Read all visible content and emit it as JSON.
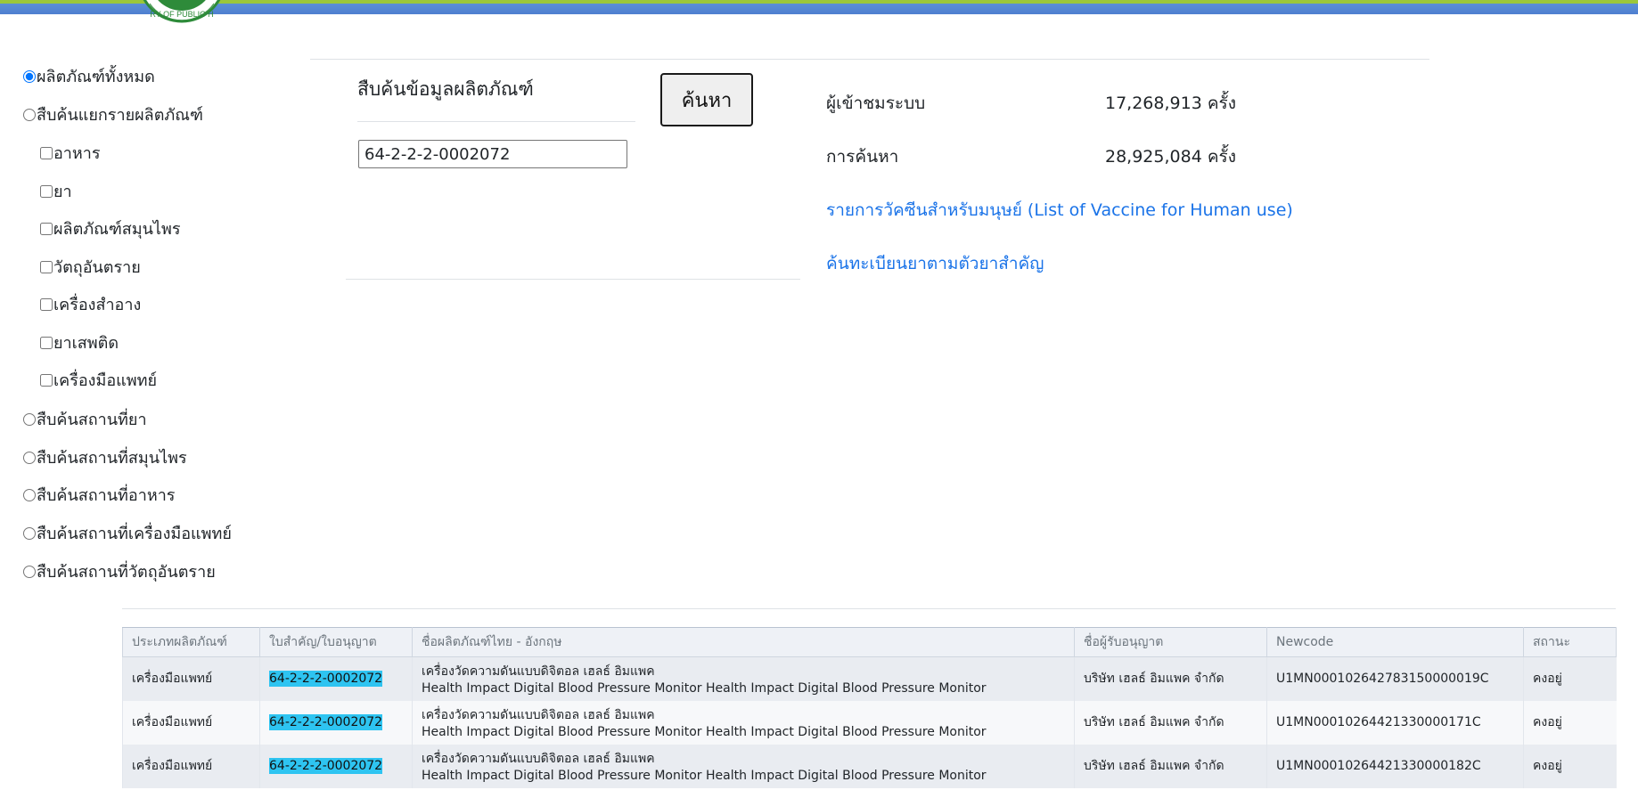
{
  "sidebar": {
    "all_products": "ผลิตภัณฑ์ทั้งหมด",
    "by_product": "สืบค้นแยกรายผลิตภัณฑ์",
    "categories": [
      {
        "label": "อาหาร"
      },
      {
        "label": "ยา"
      },
      {
        "label": "ผลิตภัณฑ์สมุนไพร"
      },
      {
        "label": "วัตถุอันตราย"
      },
      {
        "label": "เครื่องสำอาง"
      },
      {
        "label": "ยาเสพติด"
      },
      {
        "label": "เครื่องมือแพทย์"
      }
    ],
    "places": [
      {
        "label": "สืบค้นสถานที่ยา"
      },
      {
        "label": "สืบค้นสถานที่สมุนไพร"
      },
      {
        "label": "สืบค้นสถานที่อาหาร"
      },
      {
        "label": "สืบค้นสถานที่เครื่องมือแพทย์"
      },
      {
        "label": "สืบค้นสถานที่วัตถุอันตราย"
      }
    ]
  },
  "search": {
    "title": "สืบค้นข้อมูลผลิตภัณฑ์",
    "button": "ค้นหา",
    "value": "64-2-2-2-0002072"
  },
  "stats": {
    "visitors_label": "ผู้เข้าชมระบบ",
    "visitors_value": "17,268,913 ครั้ง",
    "searches_label": "การค้นหา",
    "searches_value": "28,925,084 ครั้ง"
  },
  "links": {
    "vaccine": "รายการวัคซีนสำหรับมนุษย์ (List of Vaccine for Human use)",
    "drug_search": "ค้นทะเบียนยาตามตัวยาสำคัญ"
  },
  "table": {
    "headers": [
      "ประเภทผลิตภัณฑ์",
      "ใบสำคัญ/ใบอนุญาต",
      "ชื่อผลิตภัณฑ์ไทย - อังกฤษ",
      "ชื่อผู้รับอนุญาต",
      "Newcode",
      "สถานะ"
    ],
    "rows": [
      {
        "type": "เครื่องมือแพทย์",
        "license": "64-2-2-2-0002072",
        "name_th": "เครื่องวัดความดันแบบดิจิตอล เฮลธ์ อิมแพค",
        "name_en": "Health Impact Digital Blood Pressure Monitor Health Impact Digital Blood Pressure Monitor",
        "licensee": "บริษัท เฮลธ์ อิมแพค จำกัด",
        "newcode": "U1MN000102642783150000019C",
        "status": "คงอยู่"
      },
      {
        "type": "เครื่องมือแพทย์",
        "license": "64-2-2-2-0002072",
        "name_th": "เครื่องวัดความดันแบบดิจิตอล เฮลธ์ อิมแพค",
        "name_en": "Health Impact Digital Blood Pressure Monitor Health Impact Digital Blood Pressure Monitor",
        "licensee": "บริษัท เฮลธ์ อิมแพค จำกัด",
        "newcode": "U1MN00010264421330000171C",
        "status": "คงอยู่"
      },
      {
        "type": "เครื่องมือแพทย์",
        "license": "64-2-2-2-0002072",
        "name_th": "เครื่องวัดความดันแบบดิจิตอล เฮลธ์ อิมแพค",
        "name_en": "Health Impact Digital Blood Pressure Monitor Health Impact Digital Blood Pressure Monitor",
        "licensee": "บริษัท เฮลธ์ อิมแพค จำกัด",
        "newcode": "U1MN00010264421330000182C",
        "status": "คงอยู่"
      }
    ]
  }
}
